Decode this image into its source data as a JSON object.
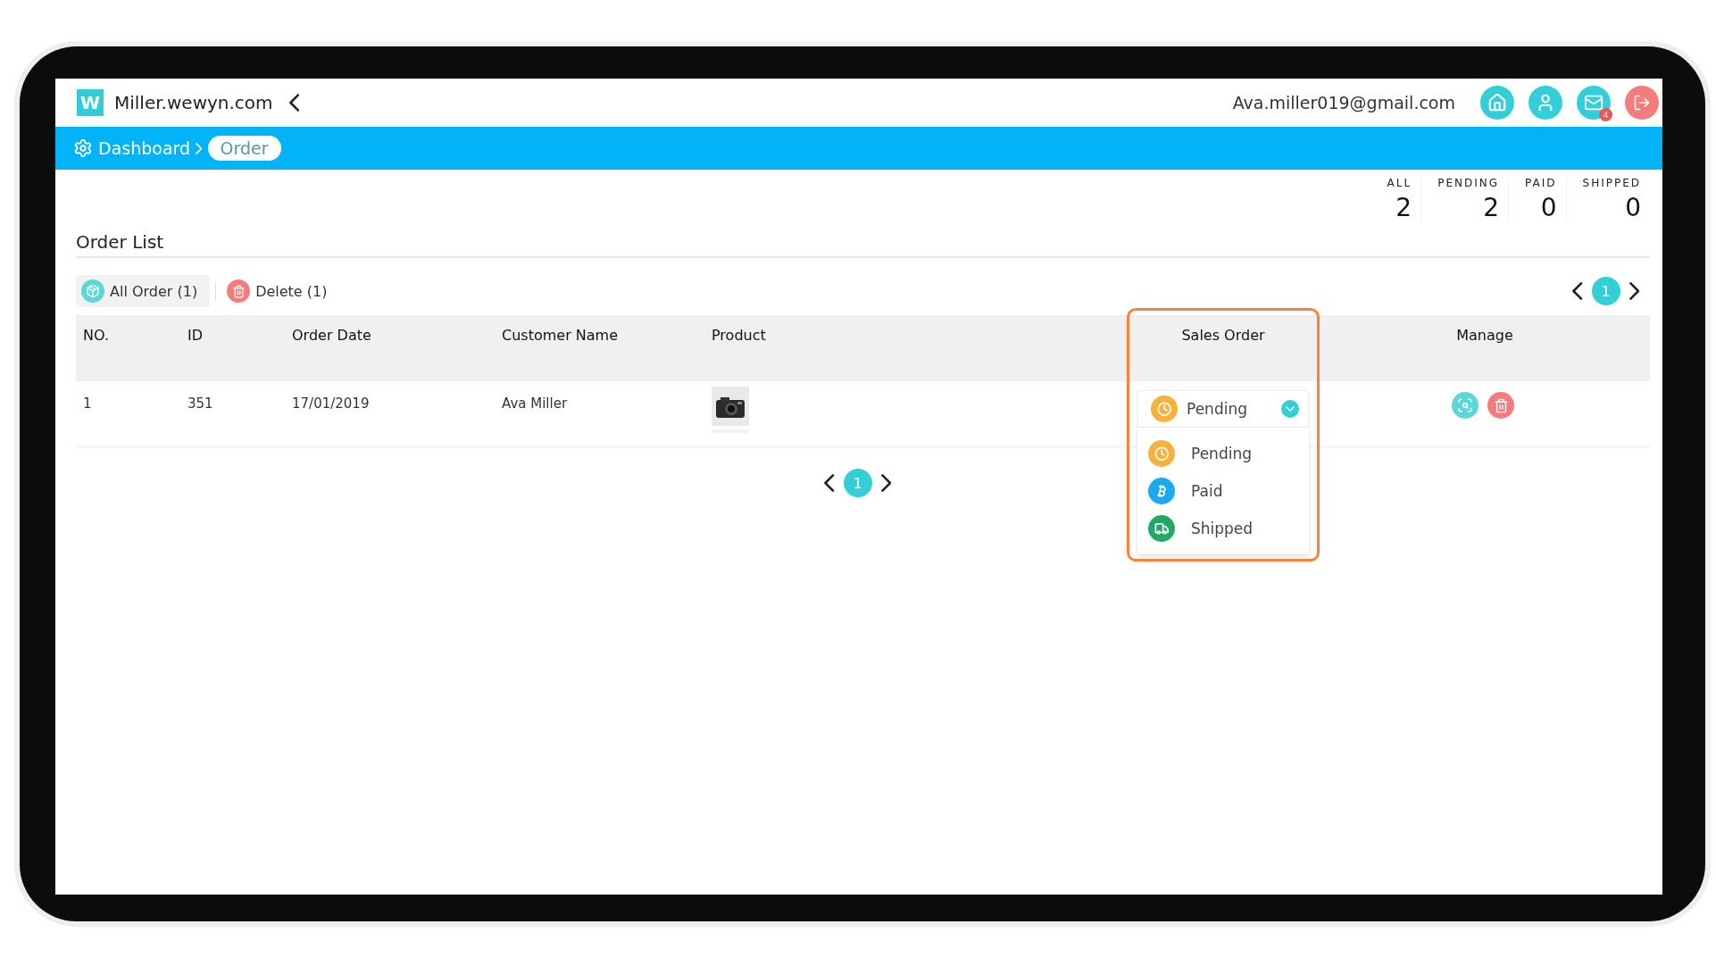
{
  "site": {
    "logo_letter": "W",
    "name": "Miller.wewyn.com"
  },
  "header": {
    "email": "Ava.miller019@gmail.com",
    "mail_badge": "4"
  },
  "breadcrumb": [
    {
      "label": "Dashboard",
      "selected": false
    },
    {
      "label": "Order",
      "selected": true
    }
  ],
  "stats": [
    {
      "label": "ALL",
      "value": "2"
    },
    {
      "label": "PENDING",
      "value": "2"
    },
    {
      "label": "PAID",
      "value": "0"
    },
    {
      "label": "SHIPPED",
      "value": "0"
    }
  ],
  "section_title": "Order List",
  "filters": [
    {
      "kind": "all",
      "label": "All Order (1)",
      "selected": true
    },
    {
      "kind": "delete",
      "label": "Delete (1)",
      "selected": false
    }
  ],
  "top_pagination": [
    {
      "label": "1",
      "selected": true
    }
  ],
  "table": {
    "columns": [
      {
        "label": "NO.",
        "highlighted": false
      },
      {
        "label": "ID",
        "highlighted": false
      },
      {
        "label": "Order Date",
        "highlighted": false
      },
      {
        "label": "Customer Name",
        "highlighted": false
      },
      {
        "label": "Product",
        "highlighted": false
      },
      {
        "label": "Sales Order",
        "highlighted": true
      },
      {
        "label": "Manage",
        "highlighted": false
      }
    ],
    "rows": [
      {
        "no": "1",
        "id": "351",
        "date": "17/01/2019",
        "customer": "Ava Miller",
        "status": {
          "kind": "pending",
          "label": "Pending"
        },
        "menu": {
          "expanded": true
        }
      }
    ]
  },
  "status_options": [
    {
      "kind": "pending",
      "label": "Pending"
    },
    {
      "kind": "paid",
      "label": "Paid"
    },
    {
      "kind": "shipped",
      "label": "Shipped"
    }
  ],
  "bottom_pagination": [
    {
      "label": "1",
      "selected": true
    }
  ]
}
